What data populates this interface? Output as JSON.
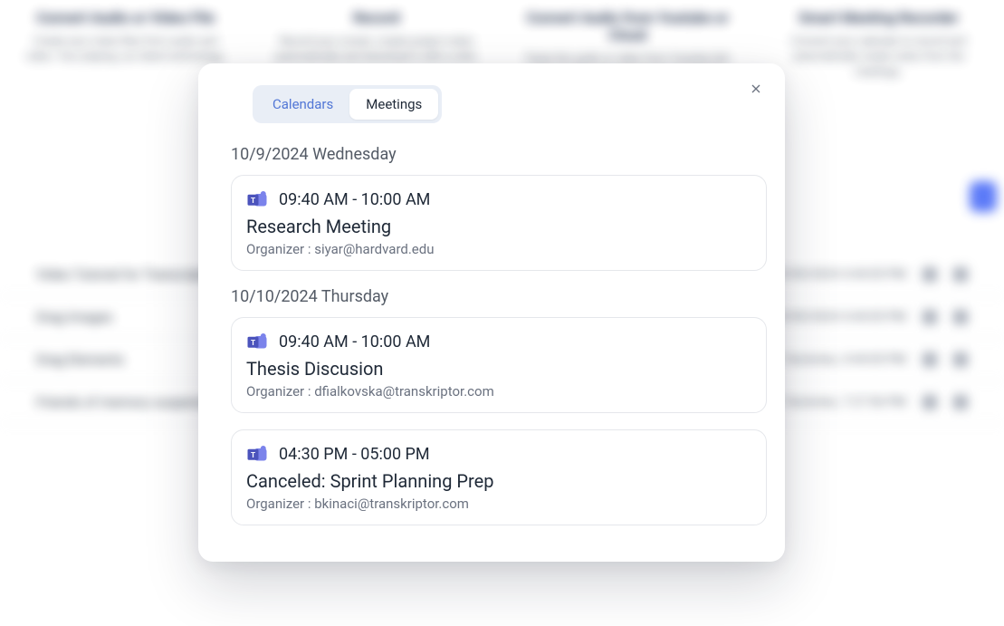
{
  "background": {
    "cards": [
      {
        "title": "Convert Audio or Video File",
        "desc": "Create your notes files from audio and video. Your playing, our latest technology."
      },
      {
        "title": "Record",
        "desc": "Record your screen, create project notes automatically and download it with a click."
      },
      {
        "title": "Convert Audio from Youtube or Cloud",
        "desc": "Paste the audio or video from Youtube link or from other storage sources to text file."
      },
      {
        "title": "Smart Meeting Recorder",
        "desc": "Connect your calendar to record and automatically create notes from the meetings."
      }
    ],
    "rows": [
      {
        "name": "Video Tutorial for Transcriptor",
        "date": "9/30/2024 4:44:05 PM"
      },
      {
        "name": "Drag Images",
        "date": "9/30/2024 4:44:05 PM"
      },
      {
        "name": "Drag Elements",
        "date": "1 factories, 4:44:05 PM"
      },
      {
        "name": "Friends of memory suspension",
        "date": "1 factories, 7:27:56 PM"
      }
    ]
  },
  "modal": {
    "tabs": {
      "calendars": "Calendars",
      "meetings": "Meetings"
    },
    "days": [
      {
        "label": "10/9/2024 Wednesday",
        "meetings": [
          {
            "time": "09:40 AM - 10:00 AM",
            "title": "Research Meeting",
            "organizer": "Organizer : siyar@hardvard.edu"
          }
        ]
      },
      {
        "label": "10/10/2024 Thursday",
        "meetings": [
          {
            "time": "09:40 AM - 10:00 AM",
            "title": "Thesis Discusion",
            "organizer": "Organizer : dfialkovska@transkriptor.com"
          },
          {
            "time": "04:30 PM - 05:00 PM",
            "title": "Canceled: Sprint Planning Prep",
            "organizer": "Organizer : bkinaci@transkriptor.com"
          }
        ]
      }
    ]
  }
}
